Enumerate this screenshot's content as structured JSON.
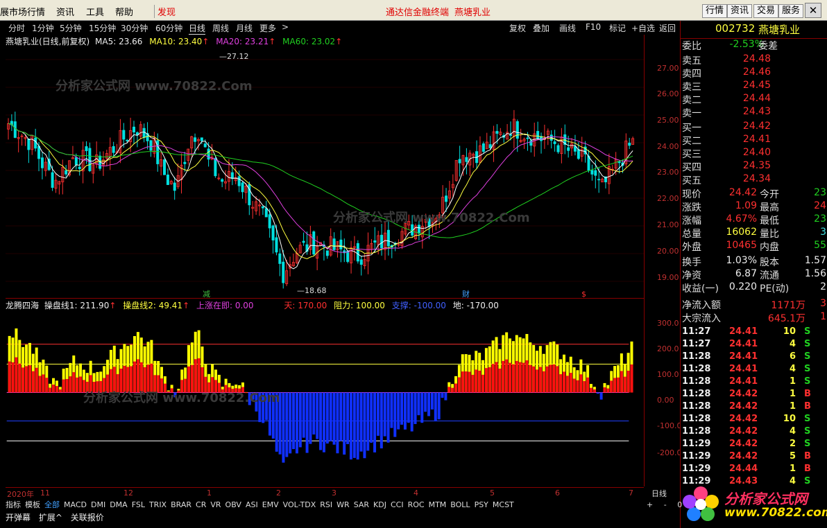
{
  "menu": {
    "items": [
      "展市场行情",
      "资讯",
      "工具",
      "帮助",
      "发现"
    ],
    "center_links": [
      "通达信金融终端",
      "燕塘乳业"
    ],
    "right_buttons": [
      "行情",
      "资讯",
      "交易",
      "服务"
    ]
  },
  "toolbar": {
    "periods": [
      "分时",
      "1分钟",
      "5分钟",
      "15分钟",
      "30分钟",
      "60分钟",
      "日线",
      "周线",
      "月线",
      "更多",
      ">"
    ],
    "active": "日线",
    "actions": [
      "复权",
      "叠加",
      "画线",
      "F10",
      "标记",
      "+自选",
      "返回"
    ]
  },
  "main_header": {
    "title": "燕塘乳业(日线,前复权)",
    "ma5": "MA5: 23.66",
    "ma10": "MA10: 23.40",
    "ma20": "MA20: 23.21",
    "ma60": "MA60: 23.02",
    "high_label": "27.12",
    "low_label": "18.68",
    "markers": [
      "减",
      "财",
      "$"
    ]
  },
  "price_axis": [
    "27.00",
    "26.00",
    "25.00",
    "24.00",
    "23.00",
    "22.00",
    "21.00",
    "20.00",
    "19.00"
  ],
  "sub_header": {
    "name": "龙腾四海",
    "line1": "操盘线1: 211.90",
    "line2": "操盘线2: 49.41",
    "up": "上涨在即: 0.00",
    "sky": "天: 170.00",
    "resist": "阻力: 100.00",
    "support": "支撑: -100.00",
    "ground": "地: -170.00"
  },
  "sub_axis": [
    "300.0",
    "200.0",
    "100.0",
    "0.00",
    "-100.0",
    "-200.0"
  ],
  "date_axis": [
    "2020年",
    "11",
    "12",
    "1",
    "2",
    "3",
    "4",
    "5",
    "6",
    "7"
  ],
  "sidebar": {
    "code": "002732",
    "name": "燕塘乳业",
    "weibi_label": "委比",
    "weibi": "-2.53%",
    "weicha_label": "委差",
    "asks": [
      {
        "label": "卖五",
        "price": "24.48"
      },
      {
        "label": "卖四",
        "price": "24.46"
      },
      {
        "label": "卖三",
        "price": "24.45"
      },
      {
        "label": "卖二",
        "price": "24.44"
      },
      {
        "label": "卖一",
        "price": "24.43"
      }
    ],
    "bids": [
      {
        "label": "买一",
        "price": "24.42"
      },
      {
        "label": "买二",
        "price": "24.41"
      },
      {
        "label": "买三",
        "price": "24.40"
      },
      {
        "label": "买四",
        "price": "24.35"
      },
      {
        "label": "买五",
        "price": "24.34"
      }
    ],
    "stats": [
      {
        "l1": "现价",
        "v1": "24.42",
        "l2": "今开",
        "v2": "23"
      },
      {
        "l1": "涨跌",
        "v1": "1.09",
        "l2": "最高",
        "v2": "24"
      },
      {
        "l1": "涨幅",
        "v1": "4.67%",
        "l2": "最低",
        "v2": "23"
      },
      {
        "l1": "总量",
        "v1": "16062",
        "l2": "量比",
        "v2": "3"
      },
      {
        "l1": "外盘",
        "v1": "10465",
        "l2": "内盘",
        "v2": "55"
      }
    ],
    "stats2": [
      {
        "l1": "换手",
        "v1": "1.03%",
        "l2": "股本",
        "v2": "1.57"
      },
      {
        "l1": "净资",
        "v1": "6.87",
        "l2": "流通",
        "v2": "1.56"
      },
      {
        "l1": "收益(一)",
        "v1": "0.220",
        "l2": "PE(动)",
        "v2": "2"
      }
    ],
    "flow": [
      {
        "label": "净流入额",
        "value": "1171万",
        "extra": "3"
      },
      {
        "label": "大宗流入",
        "value": "645.1万",
        "extra": "1"
      }
    ],
    "ticks": [
      {
        "time": "11:27",
        "price": "24.41",
        "vol": "10",
        "side": "S"
      },
      {
        "time": "11:27",
        "price": "24.41",
        "vol": "4",
        "side": "S"
      },
      {
        "time": "11:28",
        "price": "24.41",
        "vol": "6",
        "side": "S"
      },
      {
        "time": "11:28",
        "price": "24.41",
        "vol": "4",
        "side": "S"
      },
      {
        "time": "11:28",
        "price": "24.41",
        "vol": "1",
        "side": "S"
      },
      {
        "time": "11:28",
        "price": "24.42",
        "vol": "1",
        "side": "B"
      },
      {
        "time": "11:28",
        "price": "24.42",
        "vol": "1",
        "side": "B"
      },
      {
        "time": "11:28",
        "price": "24.42",
        "vol": "10",
        "side": "S"
      },
      {
        "time": "11:28",
        "price": "24.42",
        "vol": "4",
        "side": "S"
      },
      {
        "time": "11:29",
        "price": "24.42",
        "vol": "2",
        "side": "S"
      },
      {
        "time": "11:29",
        "price": "24.42",
        "vol": "5",
        "side": "B"
      },
      {
        "time": "11:29",
        "price": "24.44",
        "vol": "1",
        "side": "B"
      },
      {
        "time": "11:29",
        "price": "24.43",
        "vol": "4",
        "side": "S"
      }
    ]
  },
  "bottom": {
    "tabs": [
      "指标",
      "模板",
      "全部",
      "MACD",
      "DMI",
      "DMA",
      "FSL",
      "TRIX",
      "BRAR",
      "CR",
      "VR",
      "OBV",
      "ASI",
      "EMV",
      "VOL-TDX",
      "RSI",
      "WR",
      "SAR",
      "KDJ",
      "CCI",
      "ROC",
      "MTM",
      "BOLL",
      "PSY",
      "MCST"
    ],
    "active_tab": "全部",
    "row2": [
      "开弹幕",
      "扩展^",
      "关联报价"
    ],
    "period_label": "日线",
    "zoom": [
      "+",
      "-",
      "0"
    ]
  },
  "watermark": "分析家公式网 www.70822.Com",
  "logo_text": "分析家公式网",
  "logo_url": "www.70822.com",
  "colors": {
    "red": "#ff3030",
    "green": "#20d020",
    "yellow": "#ffff00",
    "blue": "#1040ff",
    "cyan": "#40e0e0"
  }
}
